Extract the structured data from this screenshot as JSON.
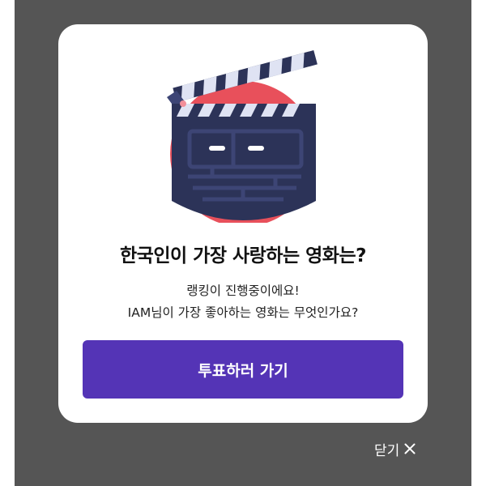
{
  "modal": {
    "title": "한국인이 가장 사랑하는 영화는?",
    "description_line1": "랭킹이 진행중이에요!",
    "description_line2": "IAM님이 가장 좋아하는 영화는 무엇인가요?",
    "vote_button_label": "투표하러 가기",
    "illustration_icon": "clapperboard-icon"
  },
  "close": {
    "label": "닫기",
    "icon": "close-icon"
  },
  "colors": {
    "overlay": "#555555",
    "accent": "#5434b6",
    "circle": "#e8505b",
    "board": "#2c3358"
  }
}
